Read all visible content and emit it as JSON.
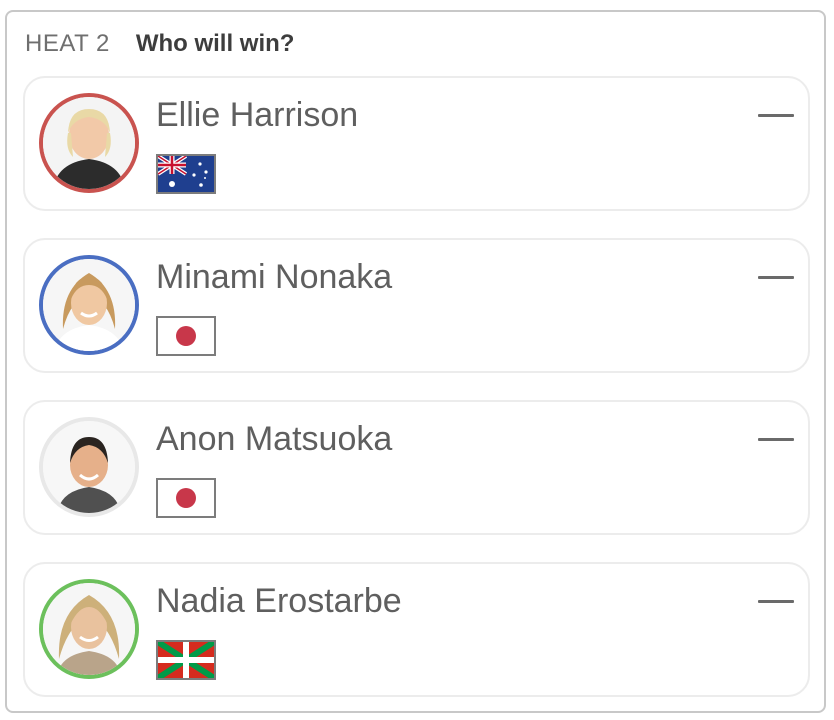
{
  "header": {
    "heat": "HEAT 2",
    "question": "Who will win?"
  },
  "colors": {
    "ring_red": "#c9534f",
    "ring_blue": "#4a6ec2",
    "ring_grey": "#e8e8e8",
    "ring_green": "#6cc05c"
  },
  "surfers": [
    {
      "name": "Ellie Harrison",
      "flag": "australia",
      "odds": "—"
    },
    {
      "name": "Minami Nonaka",
      "flag": "japan",
      "odds": "—"
    },
    {
      "name": "Anon Matsuoka",
      "flag": "japan",
      "odds": "—"
    },
    {
      "name": "Nadia Erostarbe",
      "flag": "basque-country",
      "odds": "—"
    }
  ]
}
